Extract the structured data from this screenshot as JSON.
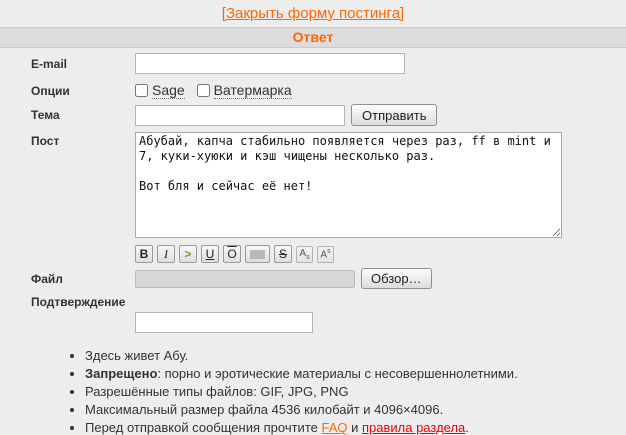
{
  "page": {
    "close_link": "[Закрыть форму постинга]",
    "form_title": "Ответ"
  },
  "form": {
    "email": {
      "label": "E-mail",
      "value": ""
    },
    "options": {
      "label": "Опции",
      "sage_label": "Sage",
      "watermark_label": "Ватермарка"
    },
    "subject": {
      "label": "Тема",
      "value": "",
      "submit_label": "Отправить"
    },
    "post": {
      "label": "Пост",
      "value": "Абубай, капча стабильно появляется через раз, ff в mint и\n7, куки-хуюки и кэш чищены несколько раз.\n\nВот бля и сейчас её нет!"
    },
    "format_buttons": [
      {
        "name": "bold",
        "glyph": "B"
      },
      {
        "name": "italic",
        "glyph": "I"
      },
      {
        "name": "quote",
        "glyph": ">"
      },
      {
        "name": "underline",
        "glyph": "U"
      },
      {
        "name": "overline",
        "glyph": "O"
      },
      {
        "name": "spoiler",
        "glyph": ""
      },
      {
        "name": "strikethrough",
        "glyph": "S"
      },
      {
        "name": "subscript",
        "glyph": "A",
        "mark": "s"
      },
      {
        "name": "superscript",
        "glyph": "A",
        "mark": "s"
      }
    ],
    "file": {
      "label": "Файл",
      "browse_label": "Обзор…"
    },
    "captcha": {
      "label": "Подтверждение",
      "value": ""
    }
  },
  "rules": {
    "item1": "Здесь живет Абу.",
    "item2_bold": "Запрещено",
    "item2_rest": ": порно и эротические материалы с несовершеннолетними.",
    "item3": "Разрешённые типы файлов: GIF, JPG, PNG",
    "item4": "Максимальный размер файла 4536 килобайт и 4096×4096.",
    "item5_pre": "Перед отправкой сообщения прочтите ",
    "item5_faq": "FAQ",
    "item5_mid": " и ",
    "item5_rules": "правила раздела",
    "item5_post": "."
  },
  "colors": {
    "accent_orange": "#ff6600",
    "link_red": "#ee0000",
    "quote_green": "#789922",
    "background": "#ededed",
    "title_bar": "#dcdcdc"
  }
}
